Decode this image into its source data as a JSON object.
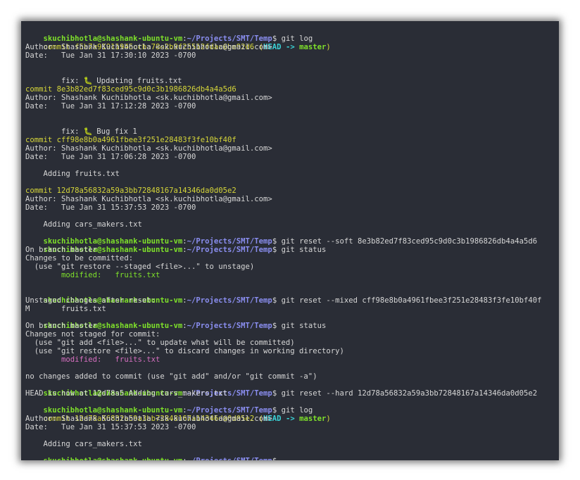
{
  "prompt": {
    "user_host": "skuchibhotla@shashank-ubuntu-vm",
    "colon": ":",
    "path": "~/Projects/SMT/Temp",
    "dollar": "$ "
  },
  "refs": {
    "open": " (",
    "head": "HEAD",
    "arrow": " -> ",
    "master": "master",
    "close": ")"
  },
  "fix_prefix": "    fix: ",
  "fix_icon": "bug-emoji",
  "lines": {
    "l1_cmd": "git log",
    "l2_commit": "commit f5b7a91911946ccba78e2b9f25512fdac6be92d6",
    "l3": "Author: Shashank Kuchibhotla <sk.kuchibhotla@gmail.com>",
    "l4": "Date:   Tue Jan 31 17:30:10 2023 -0700",
    "l6_msg": " Updating fruits.txt",
    "l8_commit": "commit 8e3b82ed7f83ced95c9d0c3b1986826db4a4a5d6",
    "l9": "Author: Shashank Kuchibhotla <sk.kuchibhotla@gmail.com>",
    "l10": "Date:   Tue Jan 31 17:12:28 2023 -0700",
    "l12_msg": " Bug fix 1",
    "l14_commit": "commit cff98e8b0a4961fbee3f251e28483f3fe10bf40f",
    "l15": "Author: Shashank Kuchibhotla <sk.kuchibhotla@gmail.com>",
    "l16": "Date:   Tue Jan 31 17:06:28 2023 -0700",
    "l18": "    Adding fruits.txt",
    "l20_commit": "commit 12d78a56832a59a3bb72848167a14346da0d05e2",
    "l21": "Author: Shashank Kuchibhotla <sk.kuchibhotla@gmail.com>",
    "l22": "Date:   Tue Jan 31 15:37:53 2023 -0700",
    "l24": "    Adding cars_makers.txt",
    "l25_cmd": "git reset --soft 8e3b82ed7f83ced95c9d0c3b1986826db4a4a5d6",
    "l26_cmd": "git status",
    "l27": "On branch master",
    "l28": "Changes to be committed:",
    "l29": "  (use \"git restore --staged <file>...\" to unstage)",
    "l30": "        modified:   fruits.txt",
    "l32_cmd": "git reset --mixed cff98e8b0a4961fbee3f251e28483f3fe10bf40f",
    "l33": "Unstaged changes after reset:",
    "l34": "M       fruits.txt",
    "l35_cmd": "git status",
    "l36": "On branch master",
    "l37": "Changes not staged for commit:",
    "l38": "  (use \"git add <file>...\" to update what will be committed)",
    "l39": "  (use \"git restore <file>...\" to discard changes in working directory)",
    "l40": "        modified:   fruits.txt",
    "l42": "no changes added to commit (use \"git add\" and/or \"git commit -a\")",
    "l43_cmd": "git reset --hard 12d78a56832a59a3bb72848167a14346da0d05e2",
    "l44": "HEAD is now at 12d78a5 Adding cars_makers.txt",
    "l45_cmd": "git log",
    "l46_commit": "commit 12d78a56832a59a3bb72848167a14346da0d05e2",
    "l47": "Author: Shashank Kuchibhotla <sk.kuchibhotla@gmail.com>",
    "l48": "Date:   Tue Jan 31 15:37:53 2023 -0700",
    "l50": "    Adding cars_makers.txt"
  },
  "colors": {
    "terminal_bg": "#2a2d36",
    "prompt_user": "#7ee02a",
    "prompt_path": "#8a8ef0",
    "commit_hash": "#d6d63a",
    "head_ref": "#3ad2d6",
    "modified_file": "#d66fc0",
    "text": "#d6d6d6"
  }
}
